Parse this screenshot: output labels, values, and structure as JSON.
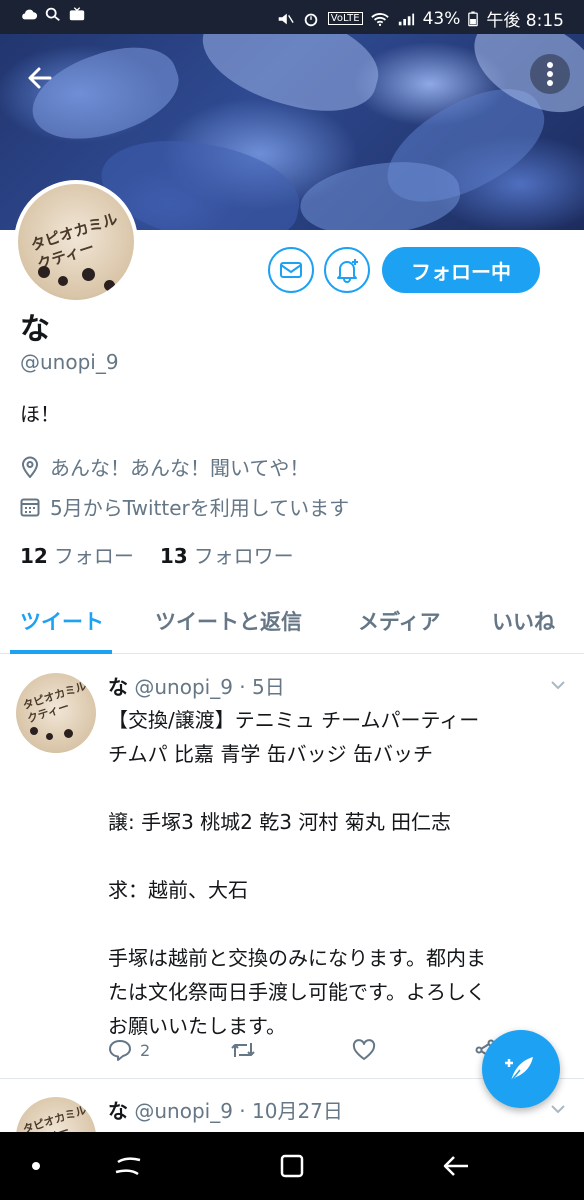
{
  "status_bar": {
    "battery": "43%",
    "time": "午後 8:15",
    "network": "VoLTE"
  },
  "header": {
    "back_icon": "arrow-left-icon",
    "more_icon": "more-vertical-icon"
  },
  "profile": {
    "avatar_text": "タピオカミルクティー",
    "display_name": "な",
    "handle": "@unopi_9",
    "bio": "ほ！",
    "location": "あんな！あんな！聞いてや！",
    "joined": "5月からTwitterを利用しています",
    "following_count": "12",
    "following_label": "フォロー",
    "followers_count": "13",
    "followers_label": "フォロワー",
    "follow_button": "フォロー中"
  },
  "tabs": [
    {
      "label": "ツイート",
      "active": true
    },
    {
      "label": "ツイートと返信",
      "active": false
    },
    {
      "label": "メディア",
      "active": false
    },
    {
      "label": "いいね",
      "active": false
    }
  ],
  "tweets": [
    {
      "name": "な",
      "handle_time": "@unopi_9 · 5日",
      "text": "【交換/譲渡】テニミュ チームパーティー\nチムパ 比嘉 青学 缶バッジ 缶バッチ\n\n譲: 手塚3 桃城2 乾3 河村 菊丸 田仁志\n\n求：越前、大石\n\n手塚は越前と交換のみになります。都内ま\nたは文化祭両日手渡し可能です。よろしく\nお願いいたします。",
      "reply_count": "2"
    },
    {
      "name": "な",
      "handle_time": "@unopi_9 · 10月27日"
    }
  ],
  "colors": {
    "accent": "#1da1f2",
    "secondary_text": "#657786",
    "primary_text": "#14171a"
  }
}
